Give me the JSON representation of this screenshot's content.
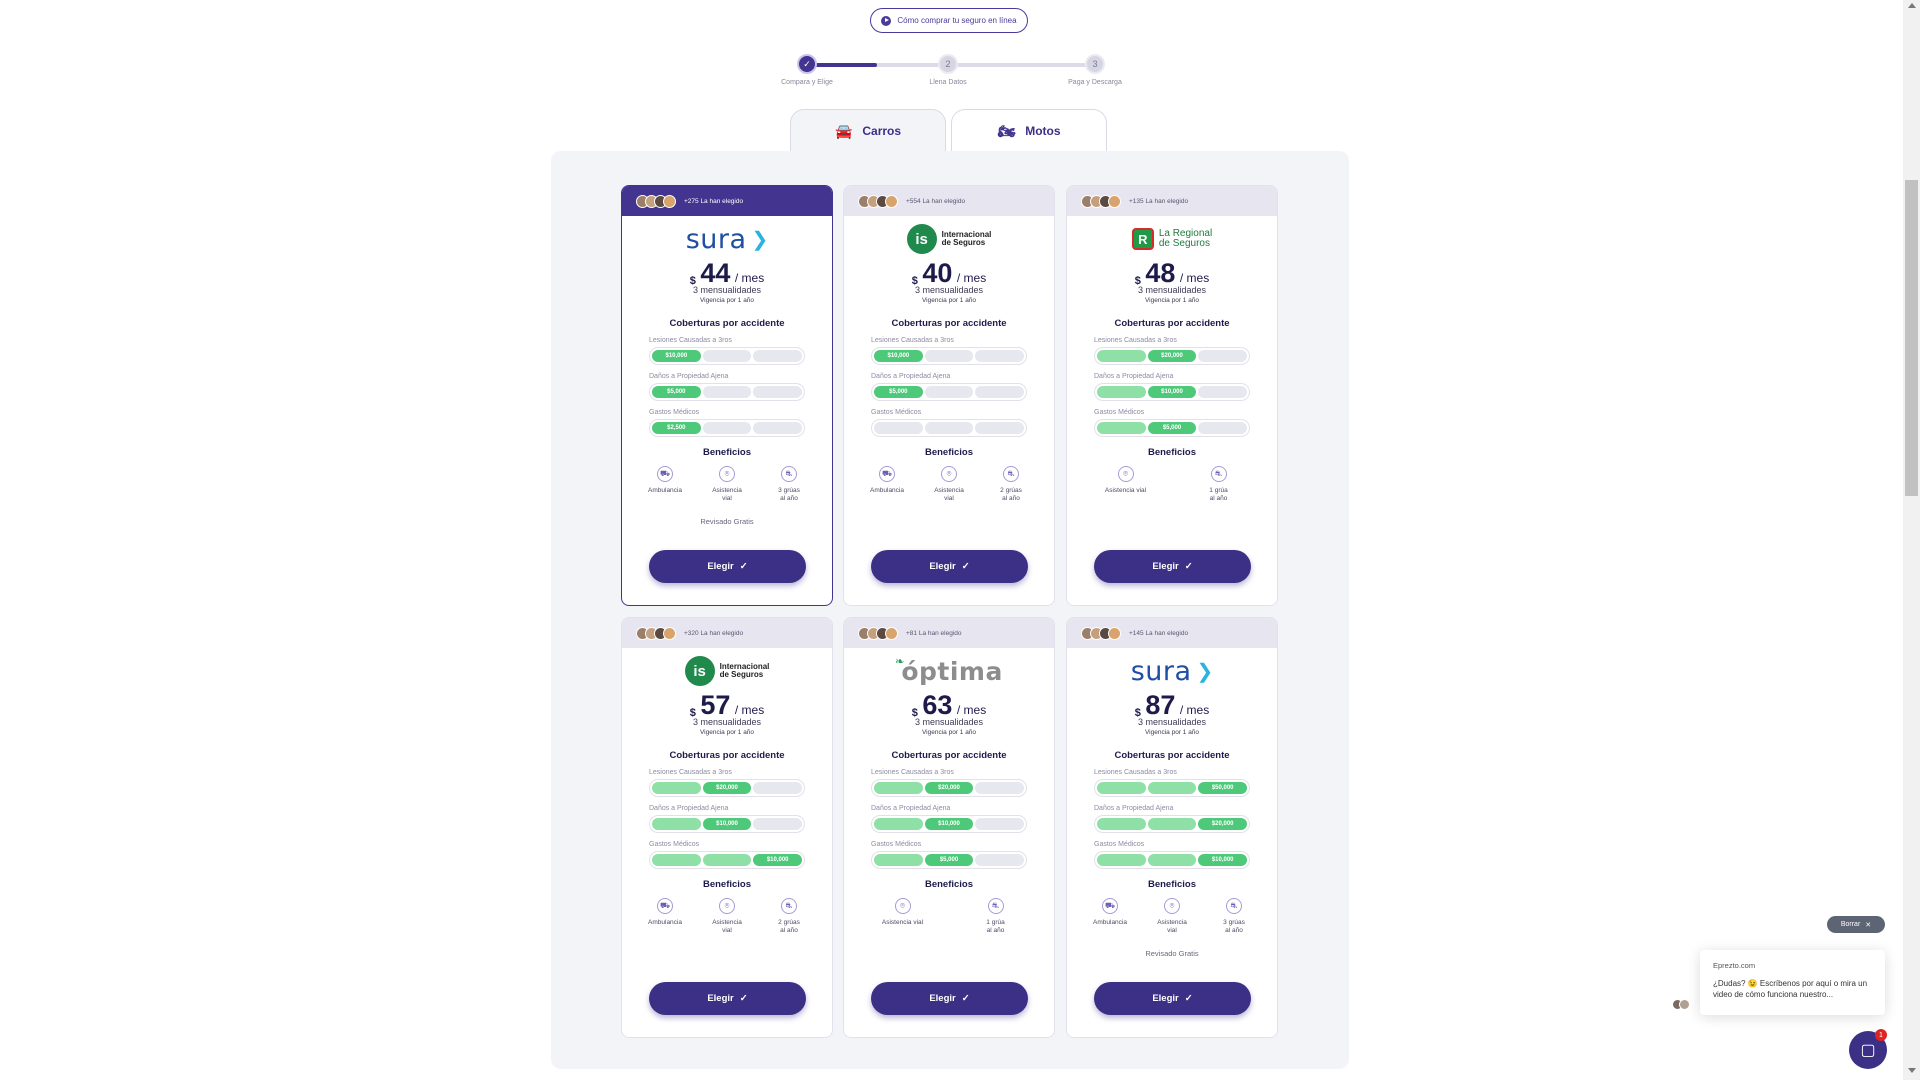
{
  "howto": {
    "label": "Cómo comprar tu seguro en línea"
  },
  "stepper": {
    "steps": [
      {
        "num": "✓",
        "label": "Compara y Elige"
      },
      {
        "num": "2",
        "label": "Llena Datos"
      },
      {
        "num": "3",
        "label": "Paga y Descarga"
      }
    ]
  },
  "tabs": [
    {
      "label": "Carros",
      "icon": "car-icon"
    },
    {
      "label": "Motos",
      "icon": "motorcycle-icon"
    }
  ],
  "common": {
    "per": "/ mes",
    "currency": "$",
    "installments": "3 mensualidades",
    "validity": "Vigencia por 1 año",
    "coverage_title": "Coberturas por accidente",
    "cov_labels": [
      "Lesiones Causadas a 3ros",
      "Daños a Propiedad Ajena",
      "Gastos Médicos"
    ],
    "benefits_title": "Beneficios",
    "choose": "Elegir"
  },
  "cards": [
    {
      "chosen": "+275 La han elegido",
      "brand": "sura",
      "price": "44",
      "covs": [
        [
          "$10,000",
          "",
          ""
        ],
        [
          "$5,000",
          "",
          ""
        ],
        [
          "$2,500",
          "",
          ""
        ]
      ],
      "benefits": [
        [
          "Ambulancia"
        ],
        [
          "Asistencia",
          "vial"
        ],
        [
          "3 grúas",
          "al año"
        ]
      ],
      "extra": "Revisado Gratis"
    },
    {
      "chosen": "+554 La han elegido",
      "brand_line1": "Internacional",
      "brand_line2": "de Seguros",
      "price": "40",
      "covs": [
        [
          "$10,000",
          "",
          ""
        ],
        [
          "$5,000",
          "",
          ""
        ],
        [
          "",
          "",
          ""
        ]
      ],
      "benefits": [
        [
          "Ambulancia"
        ],
        [
          "Asistencia",
          "vial"
        ],
        [
          "2 grúas",
          "al año"
        ]
      ]
    },
    {
      "chosen": "+135 La han elegido",
      "brand_line1": "La Regional",
      "brand_line2": "de Seguros",
      "price": "48",
      "covs": [
        [
          "",
          "$20,000",
          ""
        ],
        [
          "",
          "$10,000",
          ""
        ],
        [
          "",
          "$5,000",
          ""
        ]
      ],
      "benefits": [
        [
          "Asistencia vial"
        ],
        [
          "1 grúa",
          "al año"
        ]
      ]
    },
    {
      "chosen": "+320 La han elegido",
      "brand_line1": "Internacional",
      "brand_line2": "de Seguros",
      "price": "57",
      "covs": [
        [
          "",
          "$20,000",
          ""
        ],
        [
          "",
          "$10,000",
          ""
        ],
        [
          "",
          "",
          "$10,000"
        ]
      ],
      "benefits": [
        [
          "Ambulancia"
        ],
        [
          "Asistencia",
          "vial"
        ],
        [
          "2 grúas",
          "al año"
        ]
      ]
    },
    {
      "chosen": "+81 La han elegido",
      "brand": "óptima",
      "price": "63",
      "covs": [
        [
          "",
          "$20,000",
          ""
        ],
        [
          "",
          "$10,000",
          ""
        ],
        [
          "",
          "$5,000",
          ""
        ]
      ],
      "benefits": [
        [
          "Asistencia vial"
        ],
        [
          "1 grúa",
          "al año"
        ]
      ]
    },
    {
      "chosen": "+145 La han elegido",
      "brand": "sura",
      "price": "87",
      "covs": [
        [
          "",
          "",
          "$50,000"
        ],
        [
          "",
          "",
          "$20,000"
        ],
        [
          "",
          "",
          "$10,000"
        ]
      ],
      "benefits": [
        [
          "Ambulancia"
        ],
        [
          "Asistencia",
          "vial"
        ],
        [
          "3 grúas",
          "al año"
        ]
      ],
      "extra": "Revisado Gratis"
    }
  ],
  "chat": {
    "dismiss": "Borrar",
    "from": "Eprezto.com",
    "message": "¿Dudas? 😉 Escríbenos por aquí o mira un video de cómo funciona nuestro...",
    "badge": "1"
  },
  "colors": {
    "primary": "#3b2f86",
    "green": "#4ec97a",
    "green_light": "#8fe0a6"
  }
}
